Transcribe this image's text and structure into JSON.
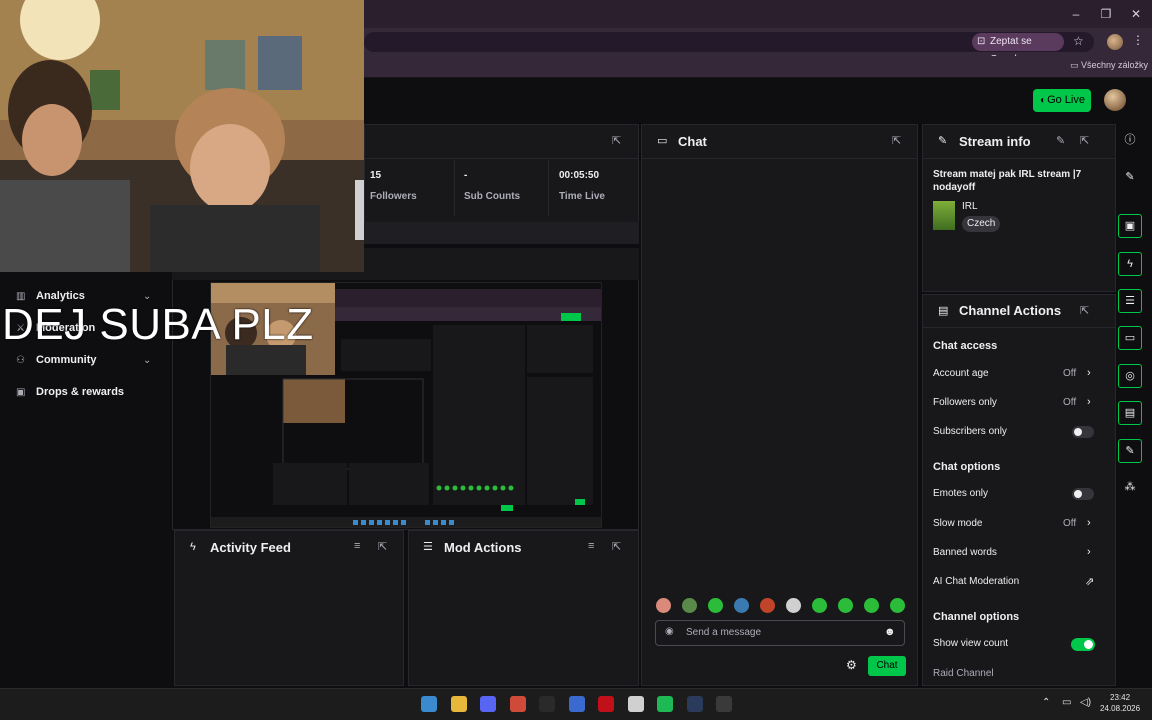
{
  "browser": {
    "ask_google_label": "Zeptat se Googlu",
    "bookmarks_folder": "Všechny záložky"
  },
  "header": {
    "go_live_label": "Go Live"
  },
  "overlay": {
    "text": "DEJ SUBA PLZ"
  },
  "left_nav": {
    "items": [
      {
        "label": "Analytics",
        "icon": "chart-icon",
        "expandable": true
      },
      {
        "label": "Moderation",
        "icon": "sword-icon",
        "expandable": false
      },
      {
        "label": "Community",
        "icon": "people-icon",
        "expandable": true
      },
      {
        "label": "Drops & rewards",
        "icon": "gift-icon",
        "expandable": false
      }
    ]
  },
  "stats": [
    {
      "value": "15",
      "label": "Followers"
    },
    {
      "value": "-",
      "label": "Sub Counts"
    },
    {
      "value": "00:05:50",
      "label": "Time Live"
    }
  ],
  "chat": {
    "title": "Chat",
    "placeholder": "Send a message",
    "send_label": "Chat",
    "emote_colors": [
      "#d98a7a",
      "#5a8a4a",
      "#2bbd3a",
      "#3a7ab0",
      "#c0442a",
      "#d0d0d0",
      "#2bbd3a",
      "#2bbd3a",
      "#2bbd3a",
      "#2bbd3a"
    ]
  },
  "stream_info": {
    "title": "Stream info",
    "stream_title": "Stream matej pak IRL stream |7 nodayoff",
    "category": "IRL",
    "language": "Czech"
  },
  "channel_actions": {
    "title": "Channel Actions",
    "chat_access_heading": "Chat access",
    "account_age": {
      "label": "Account age",
      "value": "Off"
    },
    "followers_only": {
      "label": "Followers only",
      "value": "Off"
    },
    "subscribers_only": {
      "label": "Subscribers only",
      "enabled": false
    },
    "chat_options_heading": "Chat options",
    "emotes_only": {
      "label": "Emotes only",
      "enabled": false
    },
    "slow_mode": {
      "label": "Slow mode",
      "value": "Off"
    },
    "banned_words": {
      "label": "Banned words"
    },
    "ai_chat_moderation": {
      "label": "AI Chat Moderation"
    },
    "channel_options_heading": "Channel options",
    "show_view_count": {
      "label": "Show view count",
      "enabled": true
    },
    "raid_channel": {
      "label": "Raid Channel"
    }
  },
  "activity_feed": {
    "title": "Activity Feed"
  },
  "mod_actions": {
    "title": "Mod Actions"
  },
  "taskbar": {
    "time": "23:42",
    "date": "24.08.2026",
    "apps": [
      "start",
      "file-explorer",
      "discord",
      "chrome",
      "epic-games",
      "facebook",
      "netflix",
      "app-window",
      "spotify",
      "steam",
      "obs"
    ]
  },
  "colors": {
    "accent": "#00c74a",
    "panel": "#18181b",
    "background": "#0e0e10"
  }
}
